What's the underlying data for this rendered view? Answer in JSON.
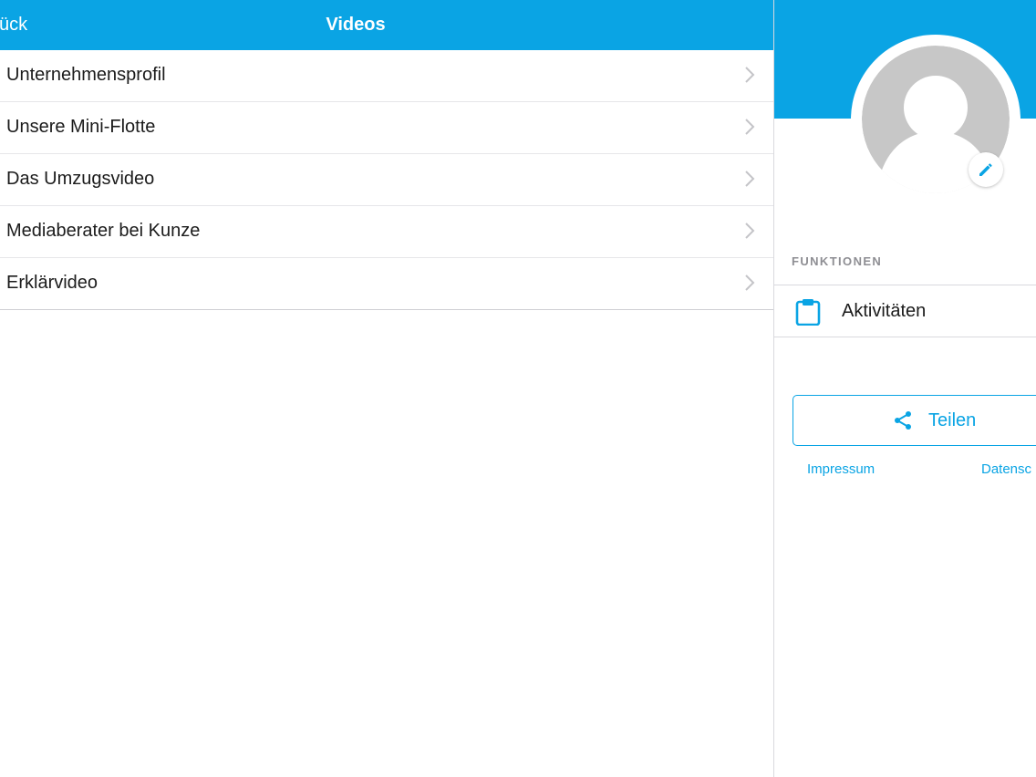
{
  "nav": {
    "back_label": "ück",
    "title": "Videos"
  },
  "videos": {
    "items": [
      {
        "label": "Unternehmensprofil"
      },
      {
        "label": "Unsere Mini-Flotte"
      },
      {
        "label": "Das Umzugsvideo"
      },
      {
        "label": "Mediaberater bei Kunze"
      },
      {
        "label": "Erklärvideo"
      }
    ]
  },
  "profile": {
    "section_label": "FUNKTIONEN",
    "functions": [
      {
        "label": "Aktivitäten",
        "icon": "clipboard-icon"
      }
    ],
    "share_label": "Teilen",
    "share_icon": "share-icon",
    "edit_icon": "pencil-icon",
    "links": {
      "impressum": "Impressum",
      "datenschutz": "Datensc"
    }
  },
  "colors": {
    "accent": "#0aa4e4",
    "text": "#1b1b1b",
    "muted": "#8e8e93",
    "avatar_placeholder": "#c7c7c7"
  }
}
